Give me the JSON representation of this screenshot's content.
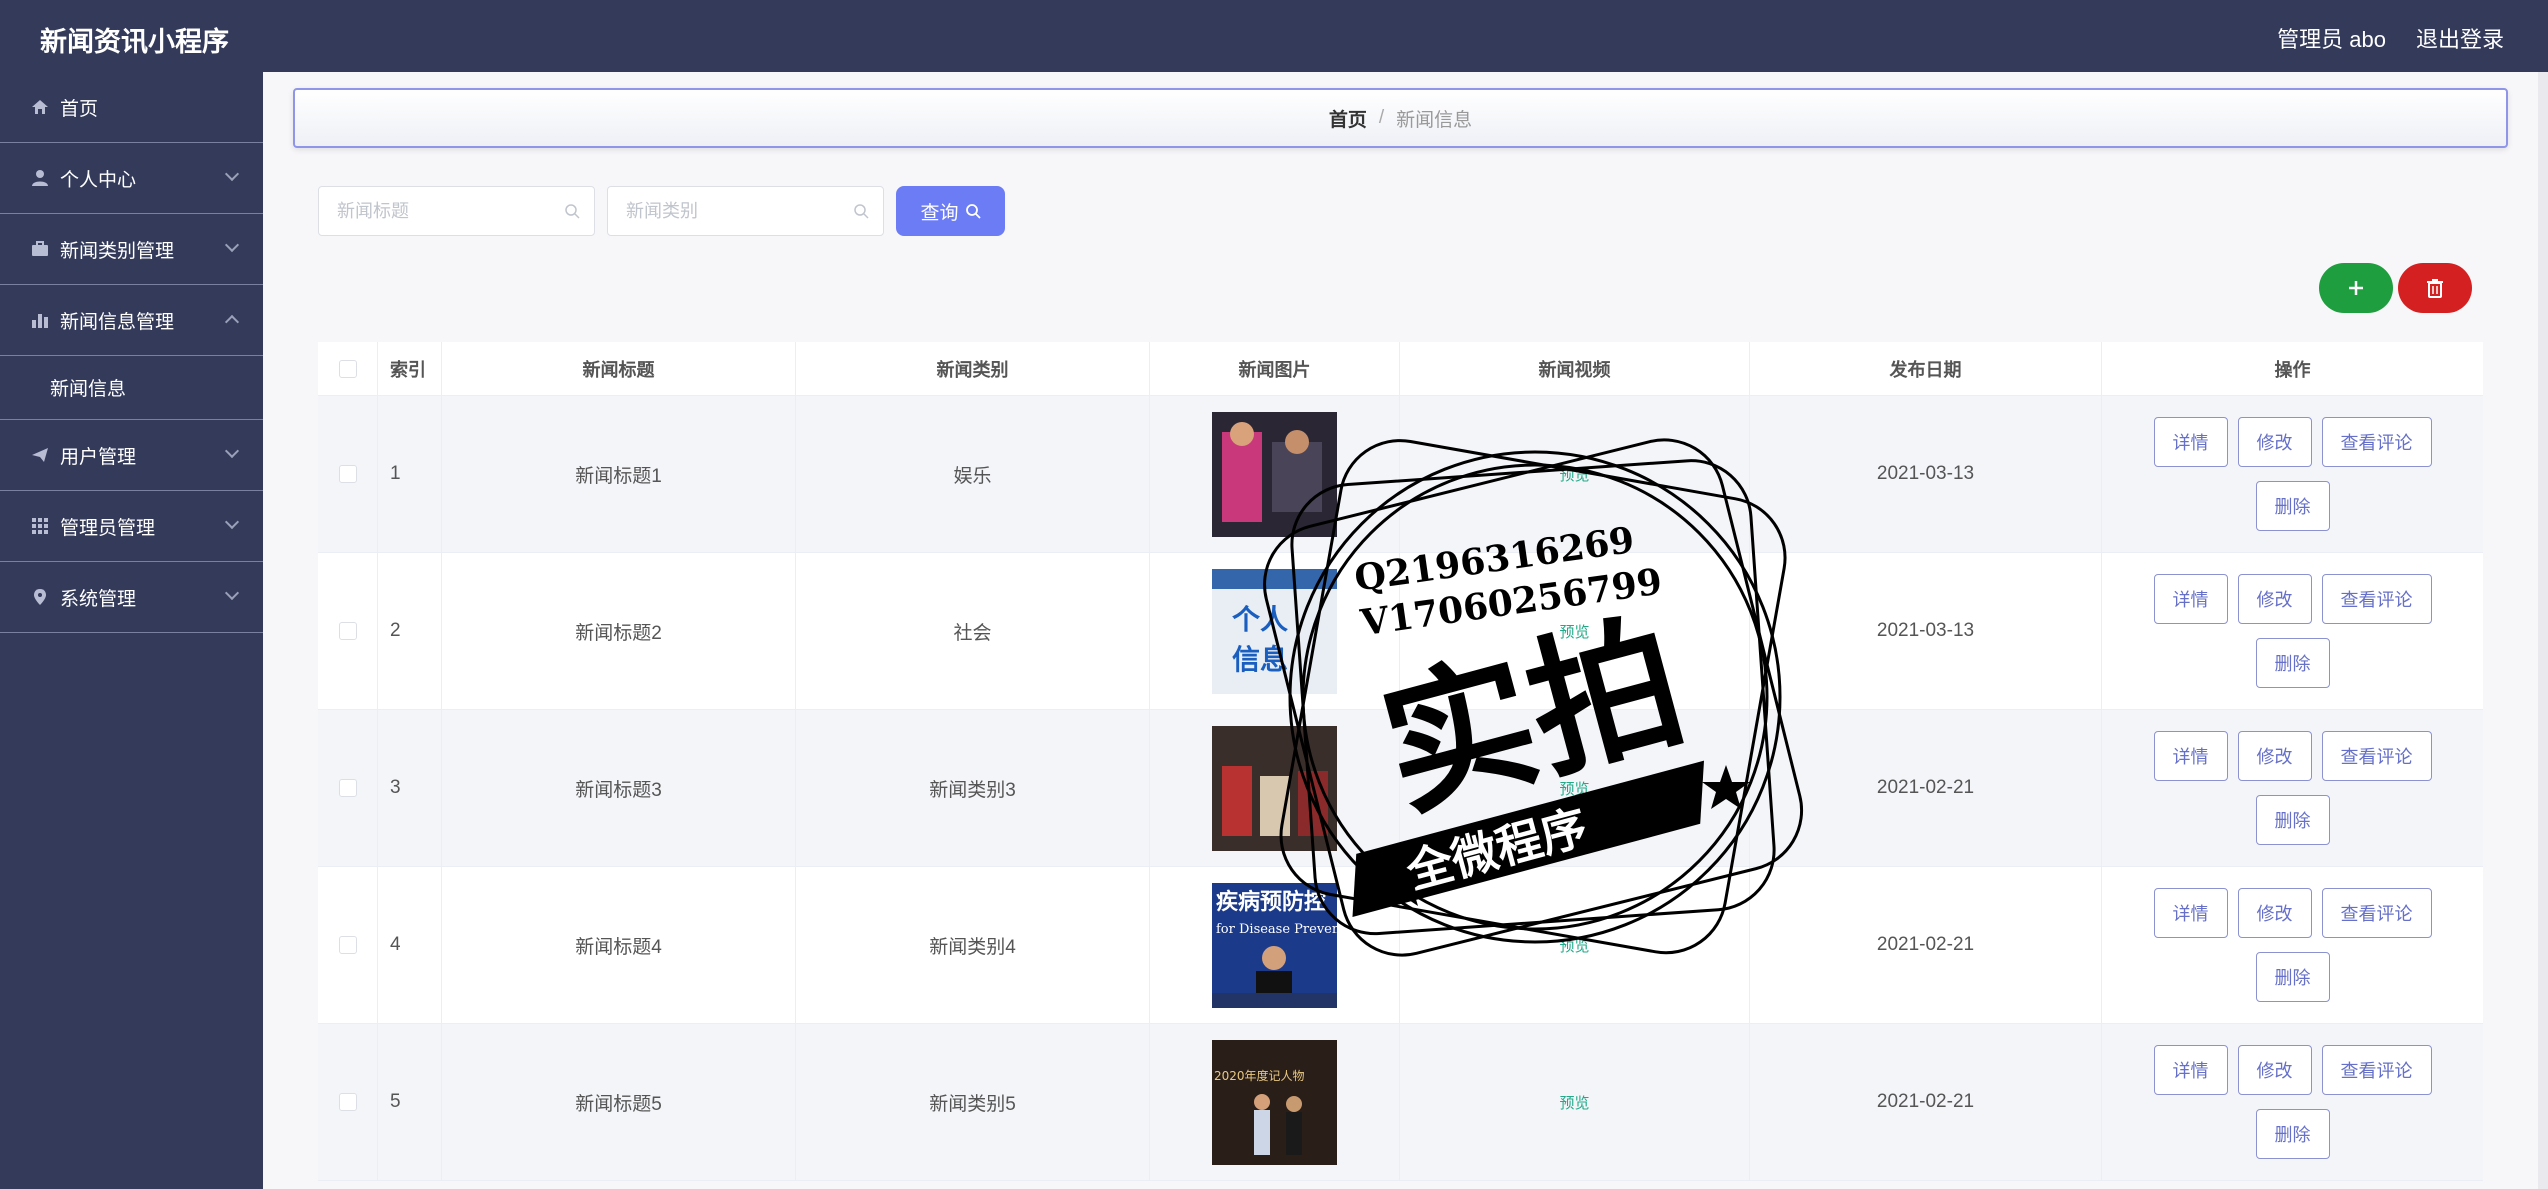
{
  "header": {
    "app_title": "新闻资讯小程序",
    "admin_label": "管理员 abo",
    "logout_label": "退出登录"
  },
  "sidebar": {
    "items": [
      {
        "label": "首页",
        "icon": "home-icon"
      },
      {
        "label": "个人中心",
        "icon": "user-icon"
      },
      {
        "label": "新闻类别管理",
        "icon": "briefcase-icon"
      },
      {
        "label": "新闻信息管理",
        "icon": "bar-chart-icon"
      },
      {
        "label": "新闻信息",
        "icon": ""
      },
      {
        "label": "用户管理",
        "icon": "send-icon"
      },
      {
        "label": "管理员管理",
        "icon": "grid-icon"
      },
      {
        "label": "系统管理",
        "icon": "location-icon"
      }
    ]
  },
  "breadcrumb": {
    "home": "首页",
    "separator": "/",
    "current": "新闻信息"
  },
  "search": {
    "title_placeholder": "新闻标题",
    "category_placeholder": "新闻类别",
    "query_label": "查询"
  },
  "table": {
    "headers": {
      "index": "索引",
      "title": "新闻标题",
      "category": "新闻类别",
      "image": "新闻图片",
      "video": "新闻视频",
      "date": "发布日期",
      "ops": "操作"
    },
    "rows": [
      {
        "index": "1",
        "title": "新闻标题1",
        "category": "娱乐",
        "video": "预览",
        "date": "2021-03-13"
      },
      {
        "index": "2",
        "title": "新闻标题2",
        "category": "社会",
        "video": "预览",
        "date": "2021-03-13"
      },
      {
        "index": "3",
        "title": "新闻标题3",
        "category": "新闻类别3",
        "video": "预览",
        "date": "2021-02-21"
      },
      {
        "index": "4",
        "title": "新闻标题4",
        "category": "新闻类别4",
        "video": "预览",
        "date": "2021-02-21"
      },
      {
        "index": "5",
        "title": "新闻标题5",
        "category": "新闻类别5",
        "video": "预览",
        "date": "2021-02-21"
      }
    ],
    "ops": {
      "detail": "详情",
      "edit": "修改",
      "comments": "查看评论",
      "delete": "删除"
    }
  },
  "watermark": {
    "line1": "Q2196316269",
    "line2": "V17060256799",
    "big_text": "实拍",
    "banner_text": "全微程序",
    "thumb_text_1": "个人",
    "thumb_text_2": "信息",
    "thumb4_text_1": "疾病预防控",
    "thumb4_text_2": "for Disease Preventio",
    "thumb5_text": "2020年度记人物"
  },
  "colors": {
    "header_bg": "#333a5a",
    "sidebar_bg": "#333a5a",
    "query_button": "#6c7cf5",
    "add_button": "#1e9e3e",
    "delete_button": "#d42020",
    "preview_link": "#22aa88"
  }
}
